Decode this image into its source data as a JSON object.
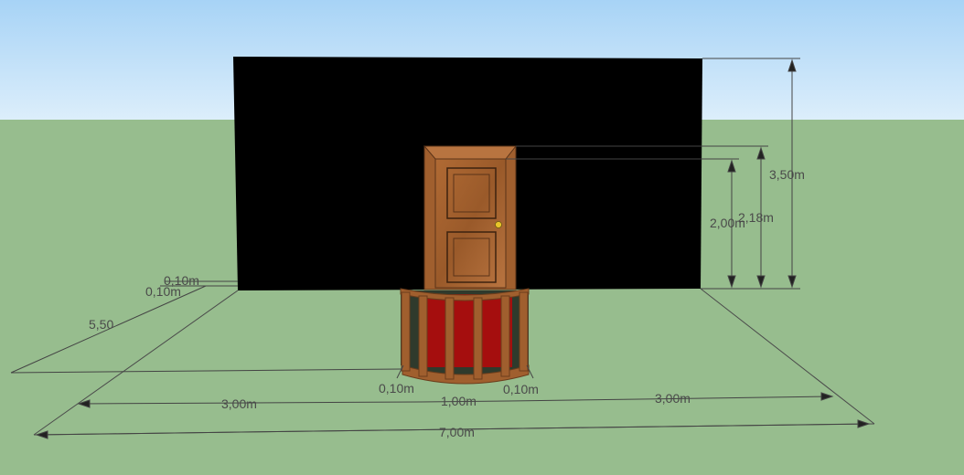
{
  "colors": {
    "sky_top": "#a7d3f6",
    "sky_bottom": "#dceefb",
    "ground": "#97bd8e",
    "wall": "#000000",
    "wood": "#a05f2e",
    "wood_dark": "#6b3d1c",
    "carpet": "#a50e0e",
    "dimension_line": "#444444",
    "door_knob": "#e8c52a"
  },
  "dimensions": {
    "wall_height": "3,50m",
    "frame_height": "2,18m",
    "door_height": "2,00m",
    "thickness_a": "0,10m",
    "thickness_b": "0,10m",
    "depth": "5,50",
    "left_width": "3,00m",
    "door_width": "1,00m",
    "right_width": "3,00m",
    "total_width": "7,00m",
    "post_left": "0,10m",
    "post_right": "0,10m"
  }
}
